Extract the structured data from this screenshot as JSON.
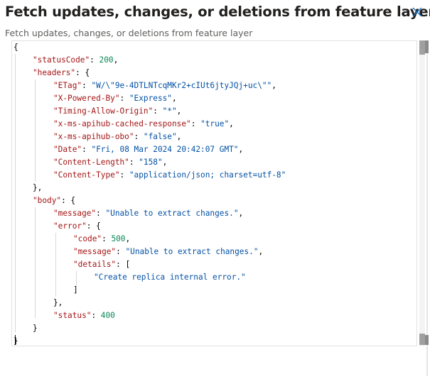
{
  "dialog": {
    "title": "Fetch updates, changes, or deletions from feature layer",
    "subtitle": "Fetch updates, changes, or deletions from feature layer",
    "close_icon": "close-icon"
  },
  "code_lines": [
    "{",
    "\"statusCode\": 200,",
    "\"headers\": {",
    "\"ETag\": \"W/\\\"9e-4DTLNTcqMKr2+cIUt6jtyJQj+uc\\\"\",",
    "\"X-Powered-By\": \"Express\",",
    "\"Timing-Allow-Origin\": \"*\",",
    "\"x-ms-apihub-cached-response\": \"true\",",
    "\"x-ms-apihub-obo\": \"false\",",
    "\"Date\": \"Fri, 08 Mar 2024 20:42:07 GMT\",",
    "\"Content-Length\": \"158\",",
    "\"Content-Type\": \"application/json; charset=utf-8\"",
    "},",
    "\"body\": {",
    "\"message\": \"Unable to extract changes.\",",
    "\"error\": {",
    "\"code\": 500,",
    "\"message\": \"Unable to extract changes.\",",
    "\"details\": [",
    "\"Create replica internal error.\"",
    "]",
    "},",
    "\"status\": 400",
    "}",
    "}"
  ],
  "colors": {
    "key": "#a31515",
    "string": "#0451a5",
    "number": "#098658",
    "punct": "#000000"
  }
}
